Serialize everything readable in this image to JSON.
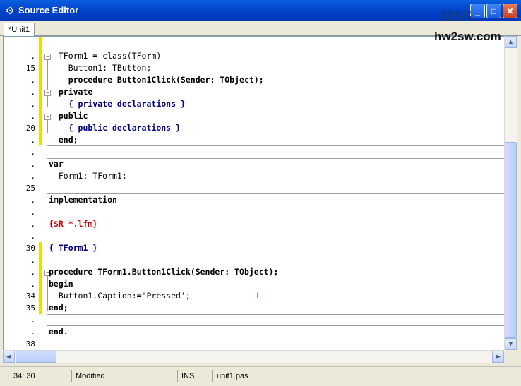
{
  "window": {
    "title": "Source Editor"
  },
  "watermark": {
    "logo": "HSS",
    "site": "hw2sw.com"
  },
  "tabs": [
    {
      "label": "*Unit1"
    }
  ],
  "editor": {
    "lines": [
      {
        "ln": ".",
        "code": "  TForm1 = class(TForm)"
      },
      {
        "ln": "15",
        "code": "    Button1: TButton;"
      },
      {
        "ln": ".",
        "code": "    procedure Button1Click(Sender: TObject);"
      },
      {
        "ln": ".",
        "code": "  private"
      },
      {
        "ln": ".",
        "code": "    { private declarations }"
      },
      {
        "ln": ".",
        "code": "  public"
      },
      {
        "ln": "20",
        "code": "    { public declarations }"
      },
      {
        "ln": ".",
        "code": "  end;"
      },
      {
        "ln": ".",
        "code": ""
      },
      {
        "ln": ".",
        "code": "var"
      },
      {
        "ln": ".",
        "code": "  Form1: TForm1;"
      },
      {
        "ln": "25",
        "code": ""
      },
      {
        "ln": ".",
        "code": "implementation"
      },
      {
        "ln": ".",
        "code": ""
      },
      {
        "ln": ".",
        "code": "{$R *.lfm}"
      },
      {
        "ln": ".",
        "code": ""
      },
      {
        "ln": "30",
        "code": "{ TForm1 }"
      },
      {
        "ln": ".",
        "code": ""
      },
      {
        "ln": ".",
        "code": "procedure TForm1.Button1Click(Sender: TObject);"
      },
      {
        "ln": ".",
        "code": "begin"
      },
      {
        "ln": "34",
        "code": "  Button1.Caption:='Pressed';"
      },
      {
        "ln": "35",
        "code": "end;"
      },
      {
        "ln": ".",
        "code": ""
      },
      {
        "ln": ".",
        "code": "end."
      },
      {
        "ln": "38",
        "code": ""
      }
    ]
  },
  "status": {
    "position": "34: 30",
    "modified": "Modified",
    "mode": "INS",
    "file": "unit1.pas"
  },
  "colors": {
    "titlebar": "#0042c8",
    "modified_marker": "#e8e000",
    "keyword": "#000000",
    "comment": "#000080",
    "directive": "#c00000",
    "string": "#0000ff"
  }
}
